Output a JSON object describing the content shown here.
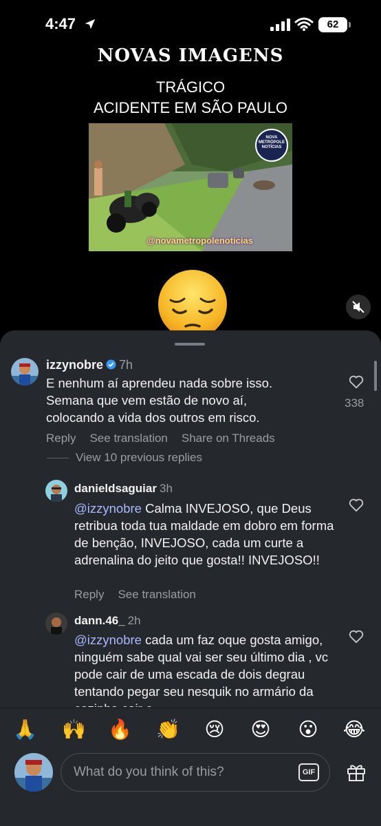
{
  "status_bar": {
    "time": "4:47",
    "battery": "62"
  },
  "post": {
    "headline": "NOVAS IMAGENS",
    "subtitle_line1": "TRÁGICO",
    "subtitle_line2": "ACIDENTE EM SÃO PAULO",
    "watermark": "@novametropolenoticias",
    "logo_text": "NOVA METRÓPOLE NOTÍCIAS",
    "emoji": "pensive-face"
  },
  "comments": [
    {
      "username": "izzynobre",
      "verified": true,
      "time": "7h",
      "text": "E nenhum aí aprendeu nada sobre isso. Semana que vem estão de novo aí, colocando a vida dos outros em risco.",
      "likes": "338",
      "actions": [
        "Reply",
        "See translation",
        "Share on Threads"
      ]
    }
  ],
  "view_replies": "View 10 previous replies",
  "replies": [
    {
      "username": "danieldsaguiar",
      "time": "3h",
      "mention": "@izzynobre",
      "text": " Calma INVEJOSO, que Deus retribua toda tua maldade em dobro em forma de benção, INVEJOSO, cada um curte a adrenalina do jeito que gosta!! INVEJOSO!!",
      "actions": [
        "Reply",
        "See translation"
      ]
    },
    {
      "username": "dann.46_",
      "time": "2h",
      "mention": "@izzynobre",
      "text": " cada um faz oque gosta amigo, ninguém sabe qual vai ser seu último dia , vc pode cair de uma escada de dois degrau tentando pegar seu nesquik no armário da cozinha cair e"
    }
  ],
  "emoji_bar": [
    "🙏",
    "🙌",
    "🔥",
    "👏",
    "😢",
    "😍",
    "😮",
    "😂"
  ],
  "composer": {
    "placeholder": "What do you think of this?",
    "gif_label": "GIF"
  }
}
